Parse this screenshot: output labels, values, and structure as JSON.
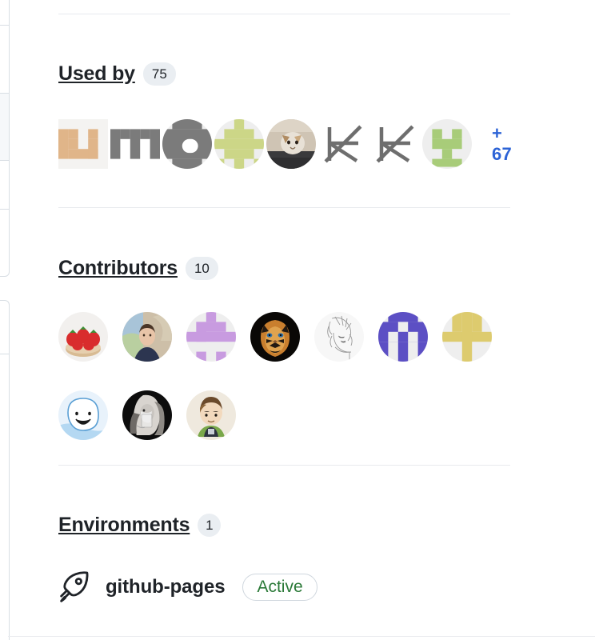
{
  "sidebar": {
    "used_by": {
      "title": "Used by",
      "count": "75",
      "more_label": "+ 67",
      "avatars": [
        {
          "name": "avatar-identicon-tan",
          "type": "identicon",
          "bg": "#ffffff",
          "fg": "#e0b589",
          "squares": [
            [
              1,
              0
            ],
            [
              3,
              0
            ],
            [
              0,
              1
            ],
            [
              1,
              1
            ],
            [
              2,
              1
            ],
            [
              3,
              1
            ],
            [
              0,
              2
            ],
            [
              1,
              2
            ],
            [
              0,
              3
            ],
            [
              1,
              3
            ],
            [
              2,
              3
            ],
            [
              3,
              3
            ]
          ]
        },
        {
          "name": "avatar-identicon-gray-m",
          "type": "identicon",
          "bg": "#ffffff",
          "fg": "#7b7b7b",
          "squares": [
            [
              0,
              1
            ],
            [
              1,
              1
            ],
            [
              3,
              1
            ],
            [
              4,
              1
            ],
            [
              0,
              2
            ],
            [
              2,
              2
            ],
            [
              4,
              2
            ],
            [
              0,
              3
            ],
            [
              2,
              3
            ],
            [
              4,
              3
            ],
            [
              0,
              4
            ],
            [
              2,
              4
            ],
            [
              4,
              4
            ]
          ]
        },
        {
          "name": "avatar-identicon-gray-a",
          "type": "identicon",
          "bg": "#eeeeee",
          "fg": "#7b7b7b",
          "squares": [
            [
              1,
              0
            ],
            [
              2,
              0
            ],
            [
              3,
              0
            ],
            [
              0,
              1
            ],
            [
              1,
              1
            ],
            [
              3,
              1
            ],
            [
              4,
              1
            ],
            [
              0,
              2
            ],
            [
              1,
              2
            ],
            [
              2,
              2
            ],
            [
              3,
              2
            ],
            [
              4,
              2
            ],
            [
              0,
              3
            ],
            [
              1,
              3
            ],
            [
              2,
              3
            ],
            [
              3,
              3
            ],
            [
              4,
              3
            ],
            [
              1,
              4
            ],
            [
              2,
              4
            ],
            [
              3,
              4
            ]
          ]
        },
        {
          "name": "avatar-identicon-green-cross",
          "type": "identicon",
          "bg": "#eeeeee",
          "fg": "#ccd687",
          "squares": [
            [
              2,
              0
            ],
            [
              1,
              1
            ],
            [
              2,
              1
            ],
            [
              3,
              1
            ],
            [
              0,
              2
            ],
            [
              1,
              2
            ],
            [
              2,
              2
            ],
            [
              3,
              2
            ],
            [
              4,
              2
            ],
            [
              1,
              3
            ],
            [
              2,
              3
            ],
            [
              3,
              3
            ],
            [
              0,
              4
            ],
            [
              2,
              4
            ],
            [
              4,
              4
            ]
          ]
        },
        {
          "name": "avatar-photo-cat",
          "type": "photo-cat",
          "bg": "#2b2b2b"
        },
        {
          "name": "avatar-logo-star-1",
          "type": "star",
          "fg": "#6e6e6e"
        },
        {
          "name": "avatar-logo-star-2",
          "type": "star",
          "fg": "#6e6e6e"
        },
        {
          "name": "avatar-identicon-green-face",
          "type": "identicon",
          "bg": "#eeeeee",
          "fg": "#a8cc79",
          "squares": [
            [
              1,
              1
            ],
            [
              3,
              1
            ],
            [
              1,
              2
            ],
            [
              2,
              2
            ],
            [
              3,
              2
            ],
            [
              2,
              3
            ],
            [
              1,
              4
            ],
            [
              2,
              4
            ],
            [
              3,
              4
            ]
          ]
        }
      ]
    },
    "contributors": {
      "title": "Contributors",
      "count": "10",
      "avatars": [
        {
          "name": "avatar-strawberries",
          "type": "strawberries"
        },
        {
          "name": "avatar-photo-person",
          "type": "photo-person"
        },
        {
          "name": "avatar-identicon-purple-light",
          "type": "identicon-round",
          "bg": "#eeeeee",
          "fg": "#c89be0",
          "squares": [
            [
              2,
              0
            ],
            [
              1,
              1
            ],
            [
              2,
              1
            ],
            [
              3,
              1
            ],
            [
              0,
              2
            ],
            [
              1,
              2
            ],
            [
              2,
              2
            ],
            [
              3,
              2
            ],
            [
              4,
              2
            ],
            [
              1,
              3
            ],
            [
              2,
              3
            ],
            [
              3,
              3
            ],
            [
              1,
              4
            ],
            [
              3,
              4
            ]
          ]
        },
        {
          "name": "avatar-tiger",
          "type": "tiger"
        },
        {
          "name": "avatar-anime-sketch",
          "type": "sketch"
        },
        {
          "name": "avatar-identicon-purple-dark",
          "type": "identicon-round",
          "bg": "#eeeeee",
          "fg": "#5c4fc4",
          "squares": [
            [
              1,
              0
            ],
            [
              2,
              0
            ],
            [
              3,
              0
            ],
            [
              0,
              1
            ],
            [
              1,
              1
            ],
            [
              3,
              1
            ],
            [
              4,
              1
            ],
            [
              0,
              2
            ],
            [
              1,
              2
            ],
            [
              2,
              2
            ],
            [
              3,
              2
            ],
            [
              4,
              2
            ],
            [
              0,
              3
            ],
            [
              2,
              3
            ],
            [
              4,
              3
            ],
            [
              0,
              4
            ],
            [
              1,
              4
            ],
            [
              3,
              4
            ],
            [
              4,
              4
            ]
          ]
        },
        {
          "name": "avatar-identicon-yellow",
          "type": "identicon-round",
          "bg": "#eeeeee",
          "fg": "#ddcb6e",
          "squares": [
            [
              1,
              0
            ],
            [
              3,
              0
            ],
            [
              1,
              1
            ],
            [
              2,
              1
            ],
            [
              3,
              1
            ],
            [
              0,
              2
            ],
            [
              1,
              2
            ],
            [
              2,
              2
            ],
            [
              3,
              2
            ],
            [
              4,
              2
            ],
            [
              2,
              3
            ],
            [
              2,
              4
            ]
          ]
        },
        {
          "name": "avatar-smiley-face",
          "type": "smiley"
        },
        {
          "name": "avatar-photo-drinking",
          "type": "photo-drinking"
        },
        {
          "name": "avatar-cartoon-boy",
          "type": "cartoon-boy"
        }
      ]
    },
    "environments": {
      "title": "Environments",
      "count": "1",
      "items": [
        {
          "icon": "rocket-icon",
          "name": "github-pages",
          "status": "Active"
        }
      ]
    }
  }
}
